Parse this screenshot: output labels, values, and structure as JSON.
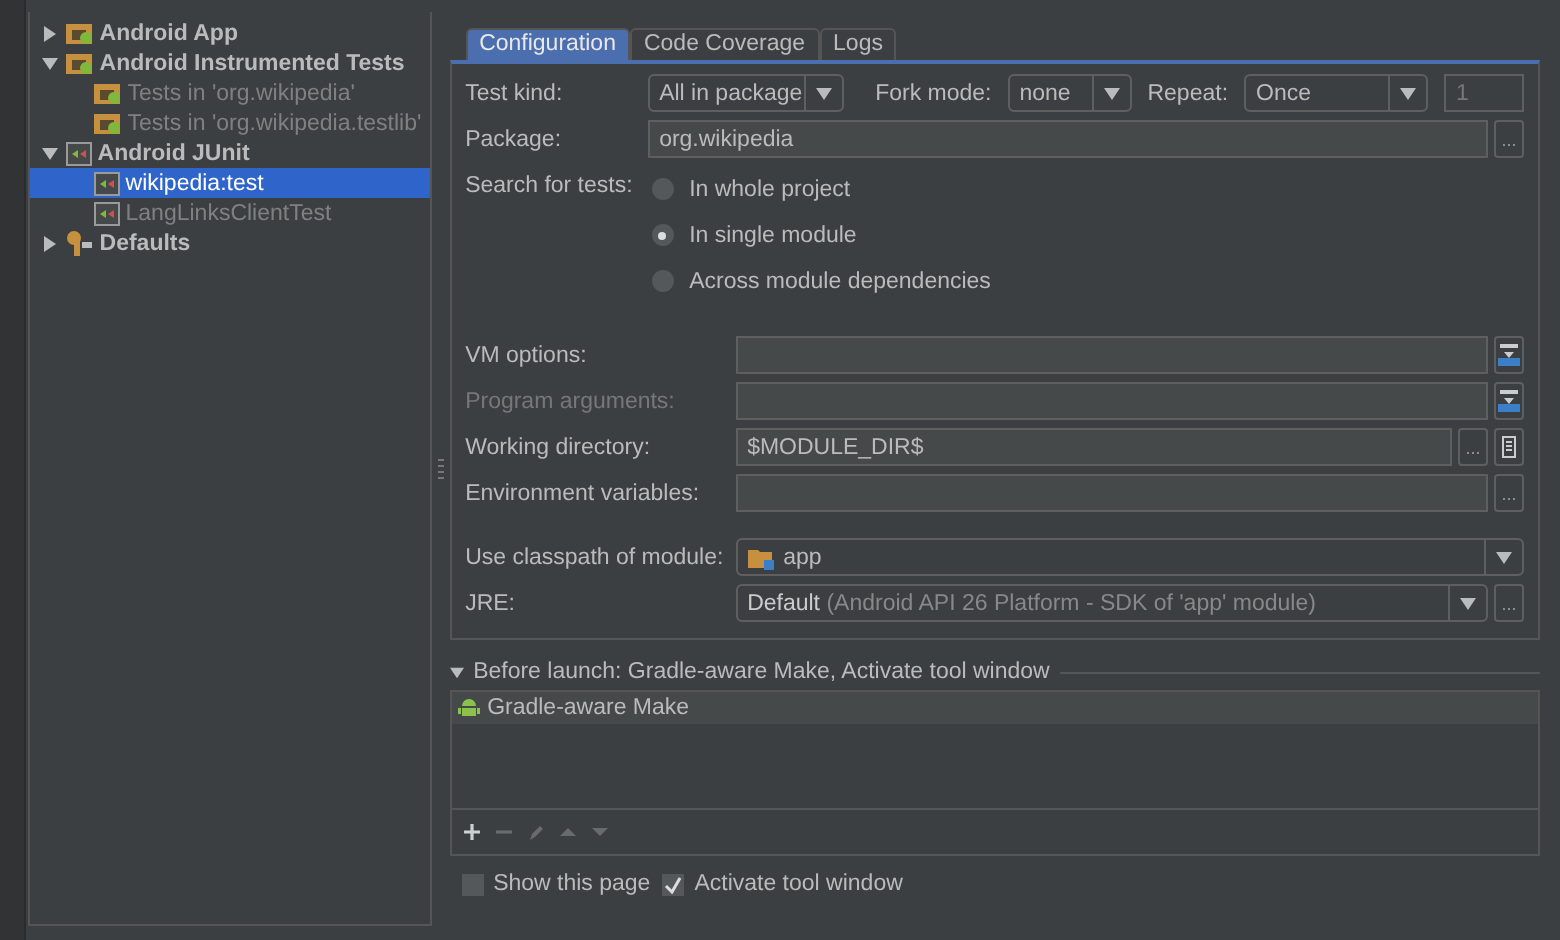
{
  "tree": [
    {
      "label": "Android App",
      "kind": "app",
      "expanded": false,
      "selected": false
    },
    {
      "label": "Android Instrumented Tests",
      "kind": "instrumented",
      "expanded": true,
      "selected": false,
      "children": [
        {
          "label": "Tests in 'org.wikipedia'",
          "kind": "instrumented",
          "selected": false,
          "temporary": true
        },
        {
          "label": "Tests in 'org.wikipedia.testlib'",
          "kind": "instrumented",
          "selected": false,
          "temporary": true
        }
      ]
    },
    {
      "label": "Android JUnit",
      "kind": "junit",
      "expanded": true,
      "selected": false,
      "children": [
        {
          "label": "wikipedia:test",
          "kind": "junit",
          "selected": true,
          "temporary": false
        },
        {
          "label": "LangLinksClientTest",
          "kind": "junit",
          "selected": false,
          "temporary": true
        }
      ]
    },
    {
      "label": "Defaults",
      "kind": "defaults",
      "expanded": false,
      "selected": false
    }
  ],
  "tabs": [
    {
      "label": "Configuration",
      "selected": true
    },
    {
      "label": "Code Coverage",
      "selected": false
    },
    {
      "label": "Logs",
      "selected": false
    }
  ],
  "test_kind": {
    "label": "Test kind:",
    "value": "All in package"
  },
  "fork_mode": {
    "label": "Fork mode:",
    "value": "none"
  },
  "repeat": {
    "label": "Repeat:",
    "value": "Once",
    "count": "1",
    "count_disabled": true
  },
  "package": {
    "label": "Package:",
    "value": "org.wikipedia",
    "browse": "..."
  },
  "search_for_tests": {
    "label": "Search for tests:",
    "options": [
      {
        "label": "In whole project",
        "selected": false
      },
      {
        "label": "In single module",
        "selected": true
      },
      {
        "label": "Across module dependencies",
        "selected": false
      }
    ]
  },
  "fields": [
    {
      "label": "VM options:",
      "kind": "expand",
      "disabled": false
    },
    {
      "label": "Program arguments:",
      "kind": "expand",
      "disabled": true
    },
    {
      "label": "Working directory:",
      "kind": "directory",
      "disabled": false,
      "value": "$MODULE_DIR$",
      "browse": "..."
    },
    {
      "label": "Environment variables:",
      "kind": "browse",
      "disabled": false,
      "browse": "..."
    }
  ],
  "classpath": {
    "label": "Use classpath of module:",
    "value": "app"
  },
  "jre": {
    "label": "JRE:",
    "value": "Default",
    "detail": "(Android API 26 Platform - SDK of 'app' module)",
    "browse": "..."
  },
  "before_launch": {
    "title": "Before launch: Gradle-aware Make, Activate tool window",
    "expanded": true,
    "tasks": [
      {
        "label": "Gradle-aware Make",
        "selected": true
      }
    ]
  },
  "toolbar": [
    {
      "kind": "add",
      "disabled": false
    },
    {
      "kind": "remove",
      "disabled": true
    },
    {
      "kind": "edit",
      "disabled": true
    },
    {
      "kind": "up",
      "disabled": true
    },
    {
      "kind": "down",
      "disabled": true
    }
  ],
  "checkboxes": [
    {
      "label": "Show this page",
      "checked": false
    },
    {
      "label": "Activate tool window",
      "checked": true
    }
  ]
}
